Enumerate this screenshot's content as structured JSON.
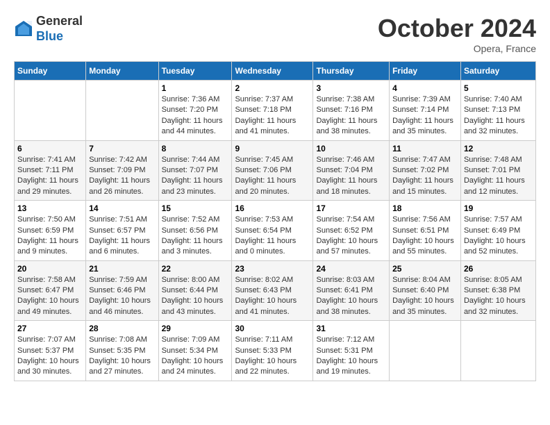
{
  "header": {
    "logo_line1": "General",
    "logo_line2": "Blue",
    "month_title": "October 2024",
    "location": "Opera, France"
  },
  "calendar": {
    "weekdays": [
      "Sunday",
      "Monday",
      "Tuesday",
      "Wednesday",
      "Thursday",
      "Friday",
      "Saturday"
    ],
    "weeks": [
      [
        {
          "day": "",
          "sunrise": "",
          "sunset": "",
          "daylight": ""
        },
        {
          "day": "",
          "sunrise": "",
          "sunset": "",
          "daylight": ""
        },
        {
          "day": "1",
          "sunrise": "Sunrise: 7:36 AM",
          "sunset": "Sunset: 7:20 PM",
          "daylight": "Daylight: 11 hours and 44 minutes."
        },
        {
          "day": "2",
          "sunrise": "Sunrise: 7:37 AM",
          "sunset": "Sunset: 7:18 PM",
          "daylight": "Daylight: 11 hours and 41 minutes."
        },
        {
          "day": "3",
          "sunrise": "Sunrise: 7:38 AM",
          "sunset": "Sunset: 7:16 PM",
          "daylight": "Daylight: 11 hours and 38 minutes."
        },
        {
          "day": "4",
          "sunrise": "Sunrise: 7:39 AM",
          "sunset": "Sunset: 7:14 PM",
          "daylight": "Daylight: 11 hours and 35 minutes."
        },
        {
          "day": "5",
          "sunrise": "Sunrise: 7:40 AM",
          "sunset": "Sunset: 7:13 PM",
          "daylight": "Daylight: 11 hours and 32 minutes."
        }
      ],
      [
        {
          "day": "6",
          "sunrise": "Sunrise: 7:41 AM",
          "sunset": "Sunset: 7:11 PM",
          "daylight": "Daylight: 11 hours and 29 minutes."
        },
        {
          "day": "7",
          "sunrise": "Sunrise: 7:42 AM",
          "sunset": "Sunset: 7:09 PM",
          "daylight": "Daylight: 11 hours and 26 minutes."
        },
        {
          "day": "8",
          "sunrise": "Sunrise: 7:44 AM",
          "sunset": "Sunset: 7:07 PM",
          "daylight": "Daylight: 11 hours and 23 minutes."
        },
        {
          "day": "9",
          "sunrise": "Sunrise: 7:45 AM",
          "sunset": "Sunset: 7:06 PM",
          "daylight": "Daylight: 11 hours and 20 minutes."
        },
        {
          "day": "10",
          "sunrise": "Sunrise: 7:46 AM",
          "sunset": "Sunset: 7:04 PM",
          "daylight": "Daylight: 11 hours and 18 minutes."
        },
        {
          "day": "11",
          "sunrise": "Sunrise: 7:47 AM",
          "sunset": "Sunset: 7:02 PM",
          "daylight": "Daylight: 11 hours and 15 minutes."
        },
        {
          "day": "12",
          "sunrise": "Sunrise: 7:48 AM",
          "sunset": "Sunset: 7:01 PM",
          "daylight": "Daylight: 11 hours and 12 minutes."
        }
      ],
      [
        {
          "day": "13",
          "sunrise": "Sunrise: 7:50 AM",
          "sunset": "Sunset: 6:59 PM",
          "daylight": "Daylight: 11 hours and 9 minutes."
        },
        {
          "day": "14",
          "sunrise": "Sunrise: 7:51 AM",
          "sunset": "Sunset: 6:57 PM",
          "daylight": "Daylight: 11 hours and 6 minutes."
        },
        {
          "day": "15",
          "sunrise": "Sunrise: 7:52 AM",
          "sunset": "Sunset: 6:56 PM",
          "daylight": "Daylight: 11 hours and 3 minutes."
        },
        {
          "day": "16",
          "sunrise": "Sunrise: 7:53 AM",
          "sunset": "Sunset: 6:54 PM",
          "daylight": "Daylight: 11 hours and 0 minutes."
        },
        {
          "day": "17",
          "sunrise": "Sunrise: 7:54 AM",
          "sunset": "Sunset: 6:52 PM",
          "daylight": "Daylight: 10 hours and 57 minutes."
        },
        {
          "day": "18",
          "sunrise": "Sunrise: 7:56 AM",
          "sunset": "Sunset: 6:51 PM",
          "daylight": "Daylight: 10 hours and 55 minutes."
        },
        {
          "day": "19",
          "sunrise": "Sunrise: 7:57 AM",
          "sunset": "Sunset: 6:49 PM",
          "daylight": "Daylight: 10 hours and 52 minutes."
        }
      ],
      [
        {
          "day": "20",
          "sunrise": "Sunrise: 7:58 AM",
          "sunset": "Sunset: 6:47 PM",
          "daylight": "Daylight: 10 hours and 49 minutes."
        },
        {
          "day": "21",
          "sunrise": "Sunrise: 7:59 AM",
          "sunset": "Sunset: 6:46 PM",
          "daylight": "Daylight: 10 hours and 46 minutes."
        },
        {
          "day": "22",
          "sunrise": "Sunrise: 8:00 AM",
          "sunset": "Sunset: 6:44 PM",
          "daylight": "Daylight: 10 hours and 43 minutes."
        },
        {
          "day": "23",
          "sunrise": "Sunrise: 8:02 AM",
          "sunset": "Sunset: 6:43 PM",
          "daylight": "Daylight: 10 hours and 41 minutes."
        },
        {
          "day": "24",
          "sunrise": "Sunrise: 8:03 AM",
          "sunset": "Sunset: 6:41 PM",
          "daylight": "Daylight: 10 hours and 38 minutes."
        },
        {
          "day": "25",
          "sunrise": "Sunrise: 8:04 AM",
          "sunset": "Sunset: 6:40 PM",
          "daylight": "Daylight: 10 hours and 35 minutes."
        },
        {
          "day": "26",
          "sunrise": "Sunrise: 8:05 AM",
          "sunset": "Sunset: 6:38 PM",
          "daylight": "Daylight: 10 hours and 32 minutes."
        }
      ],
      [
        {
          "day": "27",
          "sunrise": "Sunrise: 7:07 AM",
          "sunset": "Sunset: 5:37 PM",
          "daylight": "Daylight: 10 hours and 30 minutes."
        },
        {
          "day": "28",
          "sunrise": "Sunrise: 7:08 AM",
          "sunset": "Sunset: 5:35 PM",
          "daylight": "Daylight: 10 hours and 27 minutes."
        },
        {
          "day": "29",
          "sunrise": "Sunrise: 7:09 AM",
          "sunset": "Sunset: 5:34 PM",
          "daylight": "Daylight: 10 hours and 24 minutes."
        },
        {
          "day": "30",
          "sunrise": "Sunrise: 7:11 AM",
          "sunset": "Sunset: 5:33 PM",
          "daylight": "Daylight: 10 hours and 22 minutes."
        },
        {
          "day": "31",
          "sunrise": "Sunrise: 7:12 AM",
          "sunset": "Sunset: 5:31 PM",
          "daylight": "Daylight: 10 hours and 19 minutes."
        },
        {
          "day": "",
          "sunrise": "",
          "sunset": "",
          "daylight": ""
        },
        {
          "day": "",
          "sunrise": "",
          "sunset": "",
          "daylight": ""
        }
      ]
    ]
  }
}
